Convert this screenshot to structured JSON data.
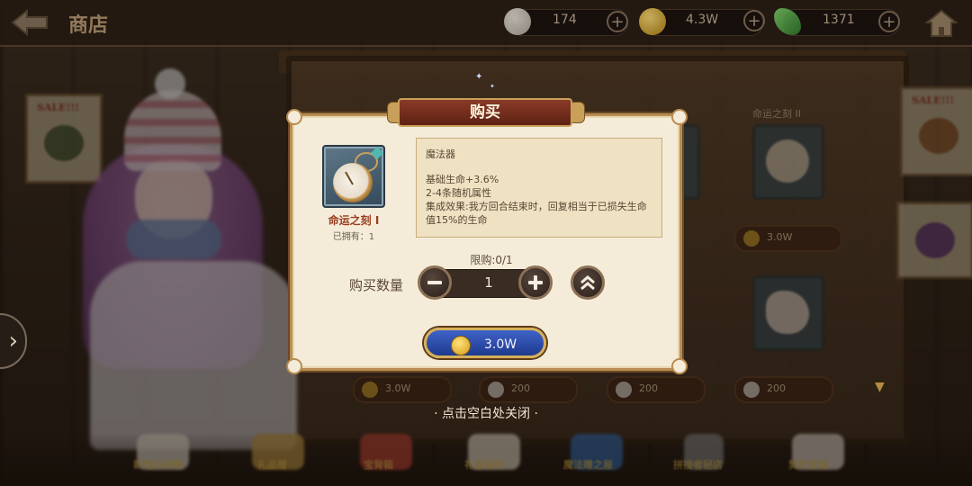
{
  "header": {
    "title": "商店",
    "resources": [
      {
        "name": "pearl",
        "value": "174",
        "color": "#e6e1d6"
      },
      {
        "name": "gold-coin",
        "value": "4.3W",
        "color": "#d8a328"
      },
      {
        "name": "green-gem",
        "value": "1371",
        "color": "#4aa84a"
      }
    ]
  },
  "background": {
    "poster_tag": "SALE!!!",
    "slot_labels": [
      "命运之刻 II"
    ],
    "prices": [
      "3.0W",
      "3.0W",
      "200",
      "200",
      "200"
    ],
    "bottom_nav": [
      "新增石神殿",
      "礼品赠",
      "宝背箱",
      "礼盒福利",
      "魔法赠之屋",
      "拼接者秘店",
      "契约宝箱"
    ]
  },
  "dialog": {
    "title": "购买",
    "item": {
      "name": "命运之刻 I",
      "owned": "已拥有：1"
    },
    "description": {
      "type": "魔法器",
      "lines": [
        "基础生命+3.6%",
        "2-4条随机属性",
        "集成效果:我方回合结束时，回复相当于已损失生命值15%的生命"
      ]
    },
    "limit": "限购:0/1",
    "quantity_label": "购买数量",
    "quantity": "1",
    "price": "3.0W"
  },
  "close_hint": "· 点击空白处关闭 ·",
  "colors": {
    "dialog_bg": "#f4ecd9",
    "title_red": "#7a2e1c",
    "buy_blue": "#2c4caa",
    "gold_border": "#c9a05a"
  }
}
